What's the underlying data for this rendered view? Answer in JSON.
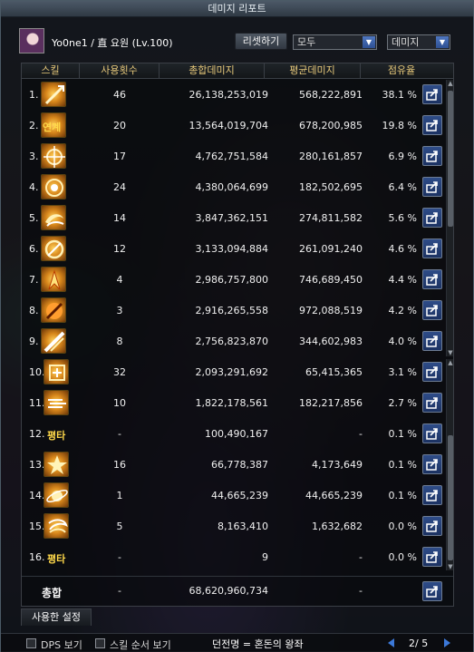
{
  "window": {
    "title": "데미지 리포트"
  },
  "header": {
    "player": "Yo0ne1 / 直 요원 (Lv.100)",
    "reset_label": "리셋하기",
    "filter_value": "모두",
    "sort_value": "데미지"
  },
  "table": {
    "columns": [
      "스킬",
      "사용횟수",
      "총합데미지",
      "평균데미지",
      "점유율"
    ],
    "rows": [
      {
        "rank": "1.",
        "icon": "spear-strike-icon",
        "icon_text": "",
        "count": "46",
        "total": "26,138,253,019",
        "avg": "568,222,891",
        "share": "38.1 %"
      },
      {
        "rank": "2.",
        "icon": "combo-text-icon",
        "icon_text": "연계",
        "count": "20",
        "total": "13,564,019,704",
        "avg": "678,200,985",
        "share": "19.8 %"
      },
      {
        "rank": "3.",
        "icon": "crosshair-icon",
        "icon_text": "",
        "count": "17",
        "total": "4,762,751,584",
        "avg": "280,161,857",
        "share": "6.9 %"
      },
      {
        "rank": "4.",
        "icon": "target-burst-icon",
        "icon_text": "",
        "count": "24",
        "total": "4,380,064,699",
        "avg": "182,502,695",
        "share": "6.4 %"
      },
      {
        "rank": "5.",
        "icon": "vortex-icon",
        "icon_text": "",
        "count": "14",
        "total": "3,847,362,151",
        "avg": "274,811,582",
        "share": "5.6 %"
      },
      {
        "rank": "6.",
        "icon": "circular-slash-icon",
        "icon_text": "",
        "count": "12",
        "total": "3,133,094,884",
        "avg": "261,091,240",
        "share": "4.6 %"
      },
      {
        "rank": "7.",
        "icon": "fire-fighter-icon",
        "icon_text": "",
        "count": "4",
        "total": "2,986,757,800",
        "avg": "746,689,450",
        "share": "4.4 %"
      },
      {
        "rank": "8.",
        "icon": "flame-orb-icon",
        "icon_text": "",
        "count": "3",
        "total": "2,916,265,558",
        "avg": "972,088,519",
        "share": "4.2 %"
      },
      {
        "rank": "9.",
        "icon": "diagonal-slash-icon",
        "icon_text": "",
        "count": "8",
        "total": "2,756,823,870",
        "avg": "344,602,983",
        "share": "4.0 %"
      },
      {
        "rank": "10.",
        "icon": "frame-cross-icon",
        "icon_text": "",
        "count": "32",
        "total": "2,093,291,692",
        "avg": "65,415,365",
        "share": "3.1 %"
      },
      {
        "rank": "11.",
        "icon": "speed-lines-icon",
        "icon_text": "",
        "count": "10",
        "total": "1,822,178,561",
        "avg": "182,217,856",
        "share": "2.7 %"
      },
      {
        "rank": "12.",
        "icon": "",
        "icon_text": "평타",
        "count": "-",
        "total": "100,490,167",
        "avg": "-",
        "share": "0.1 %"
      },
      {
        "rank": "13.",
        "icon": "explosion-icon",
        "icon_text": "",
        "count": "16",
        "total": "66,778,387",
        "avg": "4,173,649",
        "share": "0.1 %"
      },
      {
        "rank": "14.",
        "icon": "planet-ring-icon",
        "icon_text": "",
        "count": "1",
        "total": "44,665,239",
        "avg": "44,665,239",
        "share": "0.1 %"
      },
      {
        "rank": "15.",
        "icon": "whirlwind-icon",
        "icon_text": "",
        "count": "5",
        "total": "8,163,410",
        "avg": "1,632,682",
        "share": "0.0 %"
      },
      {
        "rank": "16.",
        "icon": "",
        "icon_text": "평타",
        "count": "-",
        "total": "9",
        "avg": "-",
        "share": "0.0 %"
      }
    ],
    "total": {
      "label": "총합",
      "count": "-",
      "total": "68,620,960,734",
      "avg": "-"
    }
  },
  "tabs": {
    "used_settings": "사용한 설정"
  },
  "footer": {
    "dps_label": "DPS 보기",
    "skill_order_label": "스킬 순서 보기",
    "dungeon_label": "던전명 = 혼돈의 왕좌",
    "page": "2/ 5"
  }
}
